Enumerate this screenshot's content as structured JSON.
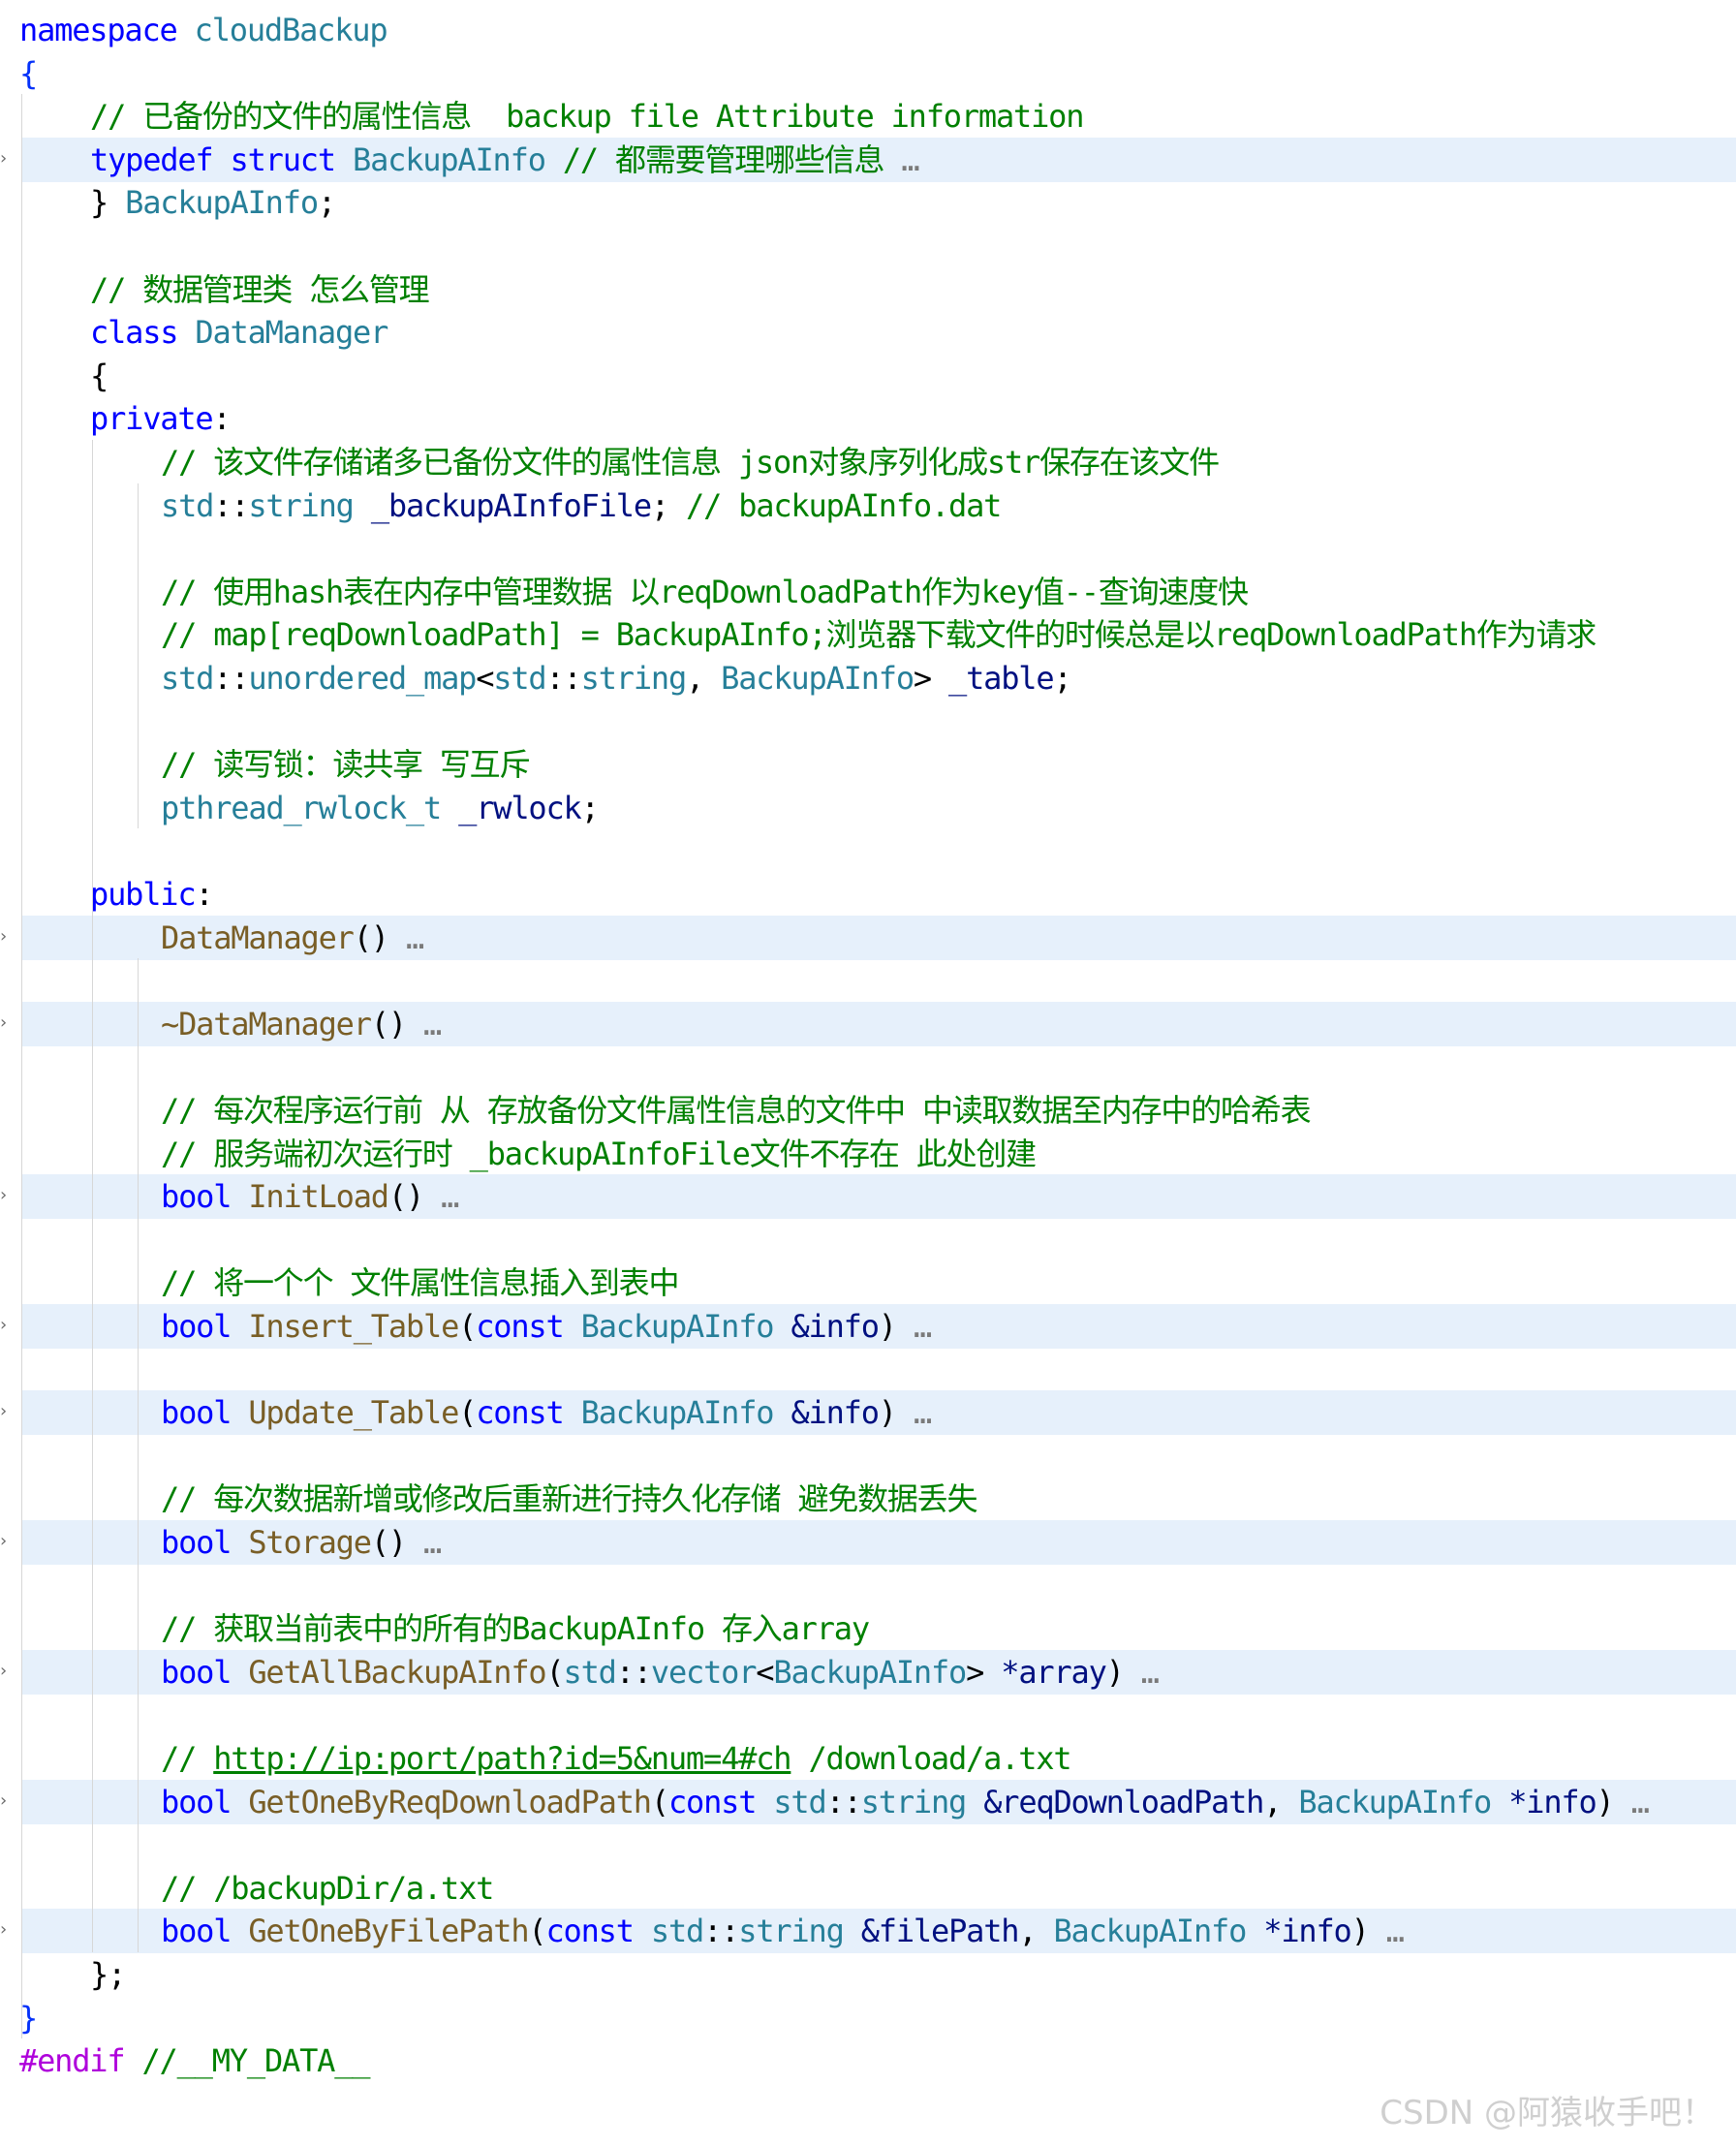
{
  "editor": {
    "lines": [
      {
        "indent": 0,
        "folded": false,
        "tokens": [
          {
            "t": "namespace",
            "c": "kw"
          },
          {
            "t": " "
          },
          {
            "t": "cloudBackup",
            "c": "type"
          }
        ]
      },
      {
        "indent": 0,
        "folded": false,
        "tokens": [
          {
            "t": "{",
            "c": "brace"
          }
        ]
      },
      {
        "indent": 1,
        "folded": false,
        "tokens": [
          {
            "t": "// 已备份的文件的属性信息  backup file Attribute information",
            "c": "cm"
          }
        ]
      },
      {
        "indent": 1,
        "folded": true,
        "tokens": [
          {
            "t": "typedef",
            "c": "kw"
          },
          {
            "t": " "
          },
          {
            "t": "struct",
            "c": "kw"
          },
          {
            "t": " "
          },
          {
            "t": "BackupAInfo",
            "c": "type"
          },
          {
            "t": " "
          },
          {
            "t": "// 都需要管理哪些信息",
            "c": "cm"
          },
          {
            "t": " …",
            "c": "dots"
          }
        ]
      },
      {
        "indent": 1,
        "folded": false,
        "tokens": [
          {
            "t": "}",
            "c": "txt"
          },
          {
            "t": " "
          },
          {
            "t": "BackupAInfo",
            "c": "type"
          },
          {
            "t": ";",
            "c": "txt"
          }
        ]
      },
      {
        "indent": 1,
        "folded": false,
        "tokens": []
      },
      {
        "indent": 1,
        "folded": false,
        "tokens": [
          {
            "t": "// 数据管理类 怎么管理",
            "c": "cm"
          }
        ]
      },
      {
        "indent": 1,
        "folded": false,
        "tokens": [
          {
            "t": "class",
            "c": "kw"
          },
          {
            "t": " "
          },
          {
            "t": "DataManager",
            "c": "type"
          }
        ]
      },
      {
        "indent": 1,
        "folded": false,
        "tokens": [
          {
            "t": "{",
            "c": "txt"
          }
        ]
      },
      {
        "indent": 1,
        "folded": false,
        "tokens": [
          {
            "t": "private",
            "c": "kw"
          },
          {
            "t": ":",
            "c": "txt"
          }
        ]
      },
      {
        "indent": 2,
        "folded": false,
        "tokens": [
          {
            "t": "// 该文件存储诸多已备份文件的属性信息 json对象序列化成str保存在该文件",
            "c": "cm"
          }
        ]
      },
      {
        "indent": 2,
        "folded": false,
        "tokens": [
          {
            "t": "std",
            "c": "type"
          },
          {
            "t": "::",
            "c": "txt"
          },
          {
            "t": "string",
            "c": "type"
          },
          {
            "t": " "
          },
          {
            "t": "_backupAInfoFile",
            "c": "var"
          },
          {
            "t": "; ",
            "c": "txt"
          },
          {
            "t": "// backupAInfo.dat",
            "c": "cm"
          }
        ]
      },
      {
        "indent": 2,
        "folded": false,
        "tokens": []
      },
      {
        "indent": 2,
        "folded": false,
        "tokens": [
          {
            "t": "// 使用hash表在内存中管理数据 以reqDownloadPath作为key值--查询速度快",
            "c": "cm"
          }
        ]
      },
      {
        "indent": 2,
        "folded": false,
        "tokens": [
          {
            "t": "// map[reqDownloadPath] = BackupAInfo;浏览器下载文件的时候总是以reqDownloadPath作为请求",
            "c": "cm"
          }
        ]
      },
      {
        "indent": 2,
        "folded": false,
        "tokens": [
          {
            "t": "std",
            "c": "type"
          },
          {
            "t": "::",
            "c": "txt"
          },
          {
            "t": "unordered_map",
            "c": "type"
          },
          {
            "t": "<",
            "c": "txt"
          },
          {
            "t": "std",
            "c": "type"
          },
          {
            "t": "::",
            "c": "txt"
          },
          {
            "t": "string",
            "c": "type"
          },
          {
            "t": ", ",
            "c": "txt"
          },
          {
            "t": "BackupAInfo",
            "c": "type"
          },
          {
            "t": "> ",
            "c": "txt"
          },
          {
            "t": "_table",
            "c": "var"
          },
          {
            "t": ";",
            "c": "txt"
          }
        ]
      },
      {
        "indent": 2,
        "folded": false,
        "tokens": []
      },
      {
        "indent": 2,
        "folded": false,
        "tokens": [
          {
            "t": "// 读写锁：读共享 写互斥",
            "c": "cm"
          }
        ]
      },
      {
        "indent": 2,
        "folded": false,
        "tokens": [
          {
            "t": "pthread_rwlock_t",
            "c": "type"
          },
          {
            "t": " "
          },
          {
            "t": "_rwlock",
            "c": "var"
          },
          {
            "t": ";",
            "c": "txt"
          }
        ]
      },
      {
        "indent": 2,
        "folded": false,
        "tokens": []
      },
      {
        "indent": 1,
        "folded": false,
        "tokens": [
          {
            "t": "public",
            "c": "kw"
          },
          {
            "t": ":",
            "c": "txt"
          }
        ]
      },
      {
        "indent": 2,
        "folded": true,
        "tokens": [
          {
            "t": "DataManager",
            "c": "fn"
          },
          {
            "t": "()",
            "c": "txt"
          },
          {
            "t": " …",
            "c": "dots"
          }
        ]
      },
      {
        "indent": 2,
        "folded": false,
        "tokens": []
      },
      {
        "indent": 2,
        "folded": true,
        "tokens": [
          {
            "t": "~DataManager",
            "c": "fn"
          },
          {
            "t": "()",
            "c": "txt"
          },
          {
            "t": " …",
            "c": "dots"
          }
        ]
      },
      {
        "indent": 2,
        "folded": false,
        "tokens": []
      },
      {
        "indent": 2,
        "folded": false,
        "tokens": [
          {
            "t": "// 每次程序运行前 从 存放备份文件属性信息的文件中 中读取数据至内存中的哈希表",
            "c": "cm"
          }
        ]
      },
      {
        "indent": 2,
        "folded": false,
        "tokens": [
          {
            "t": "// 服务端初次运行时 _backupAInfoFile文件不存在 此处创建",
            "c": "cm"
          }
        ]
      },
      {
        "indent": 2,
        "folded": true,
        "tokens": [
          {
            "t": "bool",
            "c": "kw"
          },
          {
            "t": " "
          },
          {
            "t": "InitLoad",
            "c": "fn"
          },
          {
            "t": "()",
            "c": "txt"
          },
          {
            "t": " …",
            "c": "dots"
          }
        ]
      },
      {
        "indent": 2,
        "folded": false,
        "tokens": []
      },
      {
        "indent": 2,
        "folded": false,
        "tokens": [
          {
            "t": "// 将一个个 文件属性信息插入到表中",
            "c": "cm"
          }
        ]
      },
      {
        "indent": 2,
        "folded": true,
        "tokens": [
          {
            "t": "bool",
            "c": "kw"
          },
          {
            "t": " "
          },
          {
            "t": "Insert_Table",
            "c": "fn"
          },
          {
            "t": "(",
            "c": "txt"
          },
          {
            "t": "const",
            "c": "kw"
          },
          {
            "t": " "
          },
          {
            "t": "BackupAInfo",
            "c": "type"
          },
          {
            "t": " "
          },
          {
            "t": "&info",
            "c": "var"
          },
          {
            "t": ")",
            "c": "txt"
          },
          {
            "t": " …",
            "c": "dots"
          }
        ]
      },
      {
        "indent": 2,
        "folded": false,
        "tokens": []
      },
      {
        "indent": 2,
        "folded": true,
        "tokens": [
          {
            "t": "bool",
            "c": "kw"
          },
          {
            "t": " "
          },
          {
            "t": "Update_Table",
            "c": "fn"
          },
          {
            "t": "(",
            "c": "txt"
          },
          {
            "t": "const",
            "c": "kw"
          },
          {
            "t": " "
          },
          {
            "t": "BackupAInfo",
            "c": "type"
          },
          {
            "t": " "
          },
          {
            "t": "&info",
            "c": "var"
          },
          {
            "t": ")",
            "c": "txt"
          },
          {
            "t": " …",
            "c": "dots"
          }
        ]
      },
      {
        "indent": 2,
        "folded": false,
        "tokens": []
      },
      {
        "indent": 2,
        "folded": false,
        "tokens": [
          {
            "t": "// 每次数据新增或修改后重新进行持久化存储 避免数据丢失",
            "c": "cm"
          }
        ]
      },
      {
        "indent": 2,
        "folded": true,
        "tokens": [
          {
            "t": "bool",
            "c": "kw"
          },
          {
            "t": " "
          },
          {
            "t": "Storage",
            "c": "fn"
          },
          {
            "t": "()",
            "c": "txt"
          },
          {
            "t": " …",
            "c": "dots"
          }
        ]
      },
      {
        "indent": 2,
        "folded": false,
        "tokens": []
      },
      {
        "indent": 2,
        "folded": false,
        "tokens": [
          {
            "t": "// 获取当前表中的所有的BackupAInfo 存入array",
            "c": "cm"
          }
        ]
      },
      {
        "indent": 2,
        "folded": true,
        "tokens": [
          {
            "t": "bool",
            "c": "kw"
          },
          {
            "t": " "
          },
          {
            "t": "GetAllBackupAInfo",
            "c": "fn"
          },
          {
            "t": "(",
            "c": "txt"
          },
          {
            "t": "std",
            "c": "type"
          },
          {
            "t": "::",
            "c": "txt"
          },
          {
            "t": "vector",
            "c": "type"
          },
          {
            "t": "<",
            "c": "txt"
          },
          {
            "t": "BackupAInfo",
            "c": "type"
          },
          {
            "t": "> ",
            "c": "txt"
          },
          {
            "t": "*array",
            "c": "var"
          },
          {
            "t": ")",
            "c": "txt"
          },
          {
            "t": " …",
            "c": "dots"
          }
        ]
      },
      {
        "indent": 2,
        "folded": false,
        "tokens": []
      },
      {
        "indent": 2,
        "folded": false,
        "tokens": [
          {
            "t": "// ",
            "c": "cm"
          },
          {
            "t": "http://ip:port/path?id=5&num=4#ch",
            "c": "cm link"
          },
          {
            "t": " /download/a.txt",
            "c": "cm"
          }
        ]
      },
      {
        "indent": 2,
        "folded": true,
        "tokens": [
          {
            "t": "bool",
            "c": "kw"
          },
          {
            "t": " "
          },
          {
            "t": "GetOneByReqDownloadPath",
            "c": "fn"
          },
          {
            "t": "(",
            "c": "txt"
          },
          {
            "t": "const",
            "c": "kw"
          },
          {
            "t": " "
          },
          {
            "t": "std",
            "c": "type"
          },
          {
            "t": "::",
            "c": "txt"
          },
          {
            "t": "string",
            "c": "type"
          },
          {
            "t": " "
          },
          {
            "t": "&reqDownloadPath",
            "c": "var"
          },
          {
            "t": ", ",
            "c": "txt"
          },
          {
            "t": "BackupAInfo",
            "c": "type"
          },
          {
            "t": " "
          },
          {
            "t": "*info",
            "c": "var"
          },
          {
            "t": ")",
            "c": "txt"
          },
          {
            "t": " …",
            "c": "dots"
          }
        ]
      },
      {
        "indent": 2,
        "folded": false,
        "tokens": []
      },
      {
        "indent": 2,
        "folded": false,
        "tokens": [
          {
            "t": "// /backupDir/a.txt",
            "c": "cm"
          }
        ]
      },
      {
        "indent": 2,
        "folded": true,
        "tokens": [
          {
            "t": "bool",
            "c": "kw"
          },
          {
            "t": " "
          },
          {
            "t": "GetOneByFilePath",
            "c": "fn"
          },
          {
            "t": "(",
            "c": "txt"
          },
          {
            "t": "const",
            "c": "kw"
          },
          {
            "t": " "
          },
          {
            "t": "std",
            "c": "type"
          },
          {
            "t": "::",
            "c": "txt"
          },
          {
            "t": "string",
            "c": "type"
          },
          {
            "t": " "
          },
          {
            "t": "&filePath",
            "c": "var"
          },
          {
            "t": ", ",
            "c": "txt"
          },
          {
            "t": "BackupAInfo",
            "c": "type"
          },
          {
            "t": " "
          },
          {
            "t": "*info",
            "c": "var"
          },
          {
            "t": ")",
            "c": "txt"
          },
          {
            "t": " …",
            "c": "dots"
          }
        ]
      },
      {
        "indent": 1,
        "folded": false,
        "tokens": [
          {
            "t": "};",
            "c": "txt"
          }
        ]
      },
      {
        "indent": 0,
        "folded": false,
        "tokens": [
          {
            "t": "}",
            "c": "brace"
          }
        ]
      },
      {
        "indent": 0,
        "folded": false,
        "tokens": [
          {
            "t": "#endif",
            "c": "ctrl"
          },
          {
            "t": " "
          },
          {
            "t": "//__MY_DATA__",
            "c": "cm"
          }
        ]
      }
    ],
    "fold_icon": "chevron-right-icon"
  },
  "watermark": "CSDN @阿猿收手吧！",
  "colors": {
    "keyword": "#0000ff",
    "type": "#267f99",
    "function": "#795e26",
    "variable": "#001080",
    "comment": "#008000",
    "preprocessor": "#af00db",
    "folded_background": "#e6f0fb"
  }
}
